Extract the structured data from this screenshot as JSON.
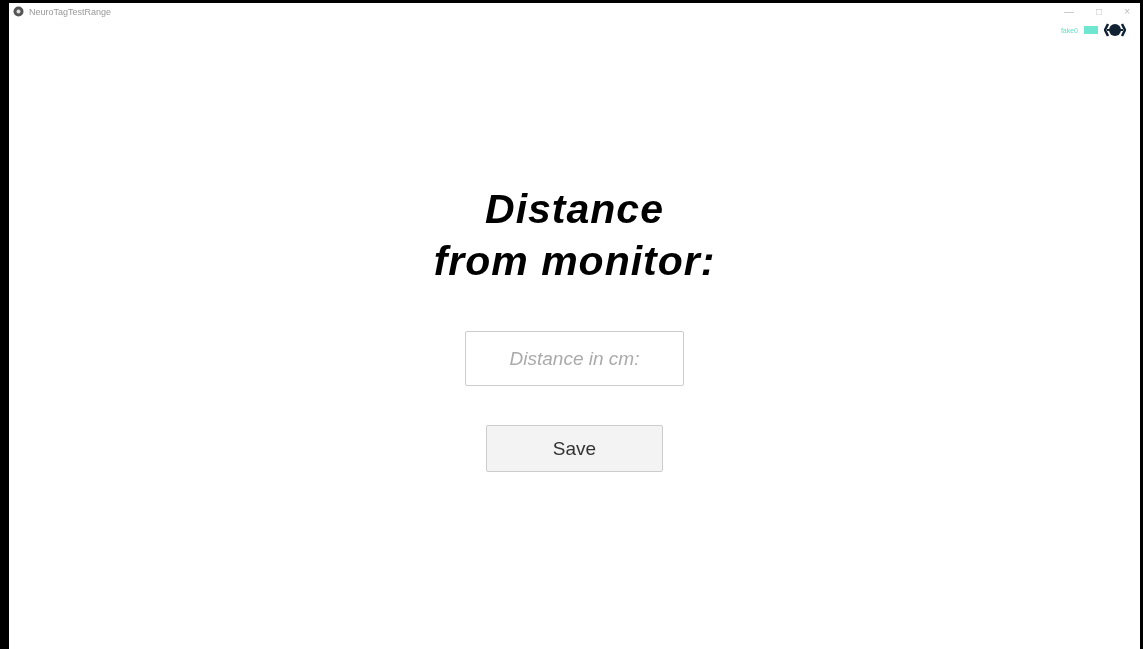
{
  "window": {
    "title": "NeuroTagTestRange",
    "controls": [
      "—",
      "□",
      "×"
    ]
  },
  "status": {
    "device": "fake0",
    "connected": true
  },
  "heading": [
    "Distance",
    "from monitor:"
  ],
  "distance_field": {
    "placeholder": "Distance in cm:"
  },
  "buttons": [
    "Save"
  ]
}
